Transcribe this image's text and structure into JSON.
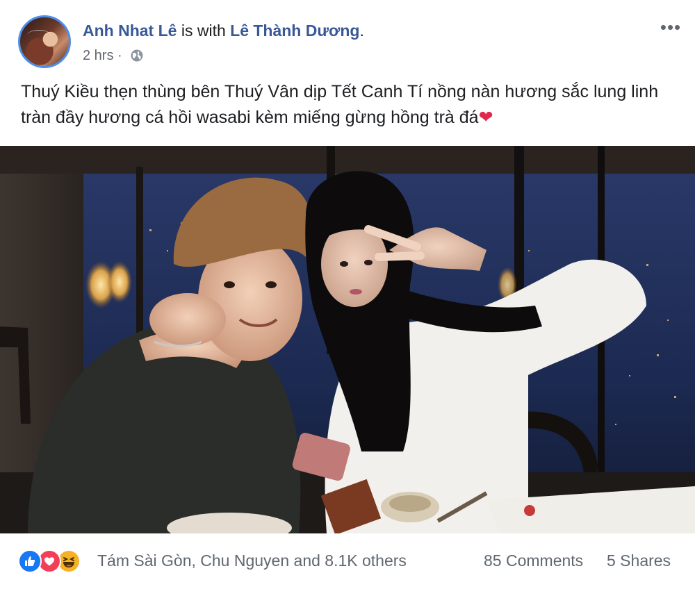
{
  "header": {
    "author_name": "Anh Nhat Lê",
    "with_text": " is with ",
    "tagged_name": "Lê Thành Dương",
    "tagged_suffix": ".",
    "timestamp": "2 hrs",
    "separator": " · ",
    "privacy_icon": "globe-icon",
    "more_label": "•••"
  },
  "caption": {
    "text": "Thuý Kiều thẹn thùng bên Thuý Vân dịp Tết Canh Tí nồng nàn hương sắc lung linh tràn đầy hương cá hồi wasabi kèm miếng gừng hồng trà đá",
    "emoji": "❤"
  },
  "photo": {
    "description_icon": "photo-image"
  },
  "footer": {
    "reaction_icons": [
      "like-icon",
      "love-icon",
      "haha-icon"
    ],
    "reaction_names": "Tám Sài Gòn, Chu Nguyen and 8.1K others",
    "comments": "85 Comments",
    "shares": "5 Shares"
  },
  "colors": {
    "link": "#385898",
    "secondary_text": "#606770",
    "like": "#1877f2",
    "love": "#f33e58",
    "haha": "#f7b125"
  }
}
